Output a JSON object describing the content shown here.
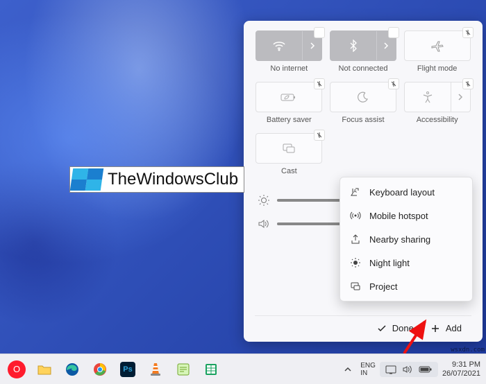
{
  "tiles": {
    "wifi": {
      "label": "No internet"
    },
    "bluetooth": {
      "label": "Not connected"
    },
    "flight": {
      "label": "Flight mode"
    },
    "battery": {
      "label": "Battery saver"
    },
    "focus": {
      "label": "Focus assist"
    },
    "accessibility": {
      "label": "Accessibility"
    },
    "cast": {
      "label": "Cast"
    }
  },
  "sliders": {
    "brightness": {
      "value": 52
    },
    "volume": {
      "value": 72
    }
  },
  "bottom": {
    "done": "Done",
    "add": "Add"
  },
  "add_menu": {
    "keyboard": "Keyboard layout",
    "hotspot": "Mobile hotspot",
    "nearby": "Nearby sharing",
    "night": "Night light",
    "project": "Project"
  },
  "watermark": "TheWindowsClub",
  "systray": {
    "lang_top": "ENG",
    "lang_bottom": "IN",
    "time": "9:31 PM",
    "date": "26/07/2021"
  },
  "attribution": "wsxdn.com"
}
